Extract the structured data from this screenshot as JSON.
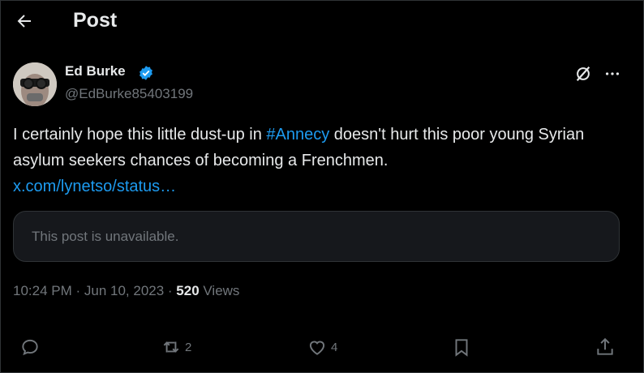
{
  "header": {
    "title": "Post"
  },
  "author": {
    "name": "Ed Burke",
    "handle": "@EdBurke85403199"
  },
  "post": {
    "text_before": "I certainly hope this little dust-up in ",
    "hashtag": "#Annecy",
    "text_after": " doesn't hurt this poor young Syrian asylum seekers chances of becoming a Frenchmen.",
    "link": "x.com/lynetso/status…"
  },
  "quote": {
    "text": "This post is unavailable."
  },
  "meta": {
    "time": "10:24 PM",
    "sep1": " · ",
    "date": "Jun 10, 2023",
    "sep2": " · ",
    "views_count": "520",
    "views_label": " Views"
  },
  "actions": {
    "reposts": "2",
    "likes": "4"
  },
  "colors": {
    "accent": "#1d9bf0",
    "muted": "#71767b",
    "text": "#e7e9ea",
    "background": "#000000"
  },
  "icons": [
    "back-arrow-icon",
    "verified-badge-icon",
    "grok-icon",
    "more-icon",
    "reply-icon",
    "repost-icon",
    "like-icon",
    "bookmark-icon",
    "share-icon"
  ]
}
